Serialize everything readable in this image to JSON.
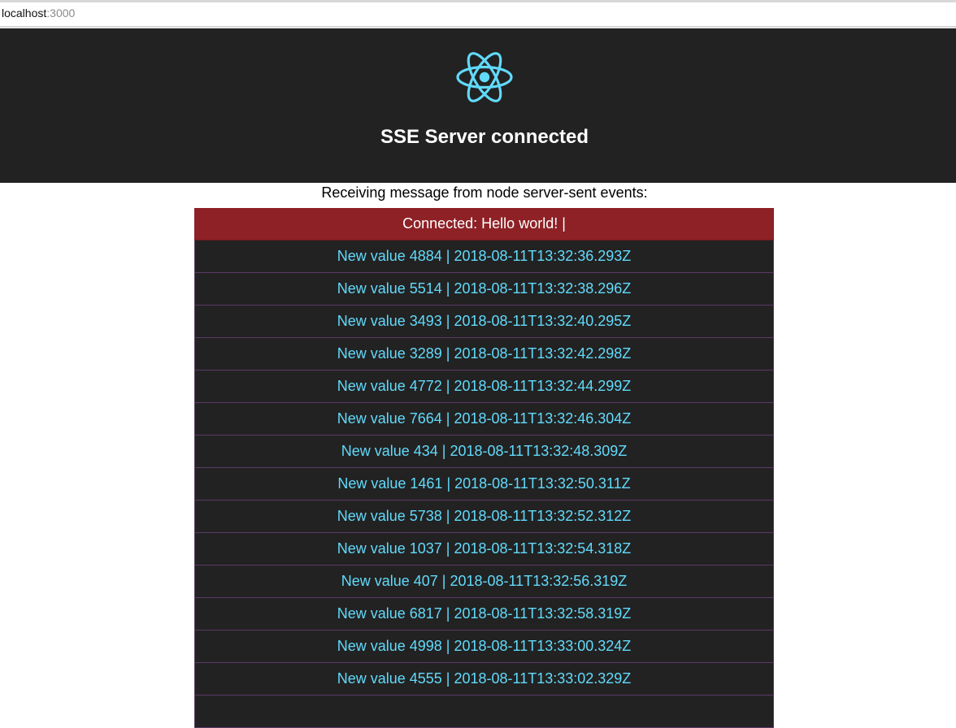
{
  "browser": {
    "url_host": "localhost",
    "url_port": ":3000"
  },
  "header": {
    "logo_icon": "react-logo-icon",
    "logo_color": "#61dafb",
    "title": "SSE Server connected",
    "background": "#222222"
  },
  "intro": "Receiving message from node server-sent events:",
  "messages": {
    "connected": "Connected: Hello world! |",
    "connected_color": "#8e2126",
    "value_color": "#61dafb",
    "items": [
      "New value 4884 | 2018-08-11T13:32:36.293Z",
      "New value 5514 | 2018-08-11T13:32:38.296Z",
      "New value 3493 | 2018-08-11T13:32:40.295Z",
      "New value 3289 | 2018-08-11T13:32:42.298Z",
      "New value 4772 | 2018-08-11T13:32:44.299Z",
      "New value 7664 | 2018-08-11T13:32:46.304Z",
      "New value 434 | 2018-08-11T13:32:48.309Z",
      "New value 1461 | 2018-08-11T13:32:50.311Z",
      "New value 5738 | 2018-08-11T13:32:52.312Z",
      "New value 1037 | 2018-08-11T13:32:54.318Z",
      "New value 407 | 2018-08-11T13:32:56.319Z",
      "New value 6817 | 2018-08-11T13:32:58.319Z",
      "New value 4998 | 2018-08-11T13:33:00.324Z",
      "New value 4555 | 2018-08-11T13:33:02.329Z",
      ""
    ]
  }
}
